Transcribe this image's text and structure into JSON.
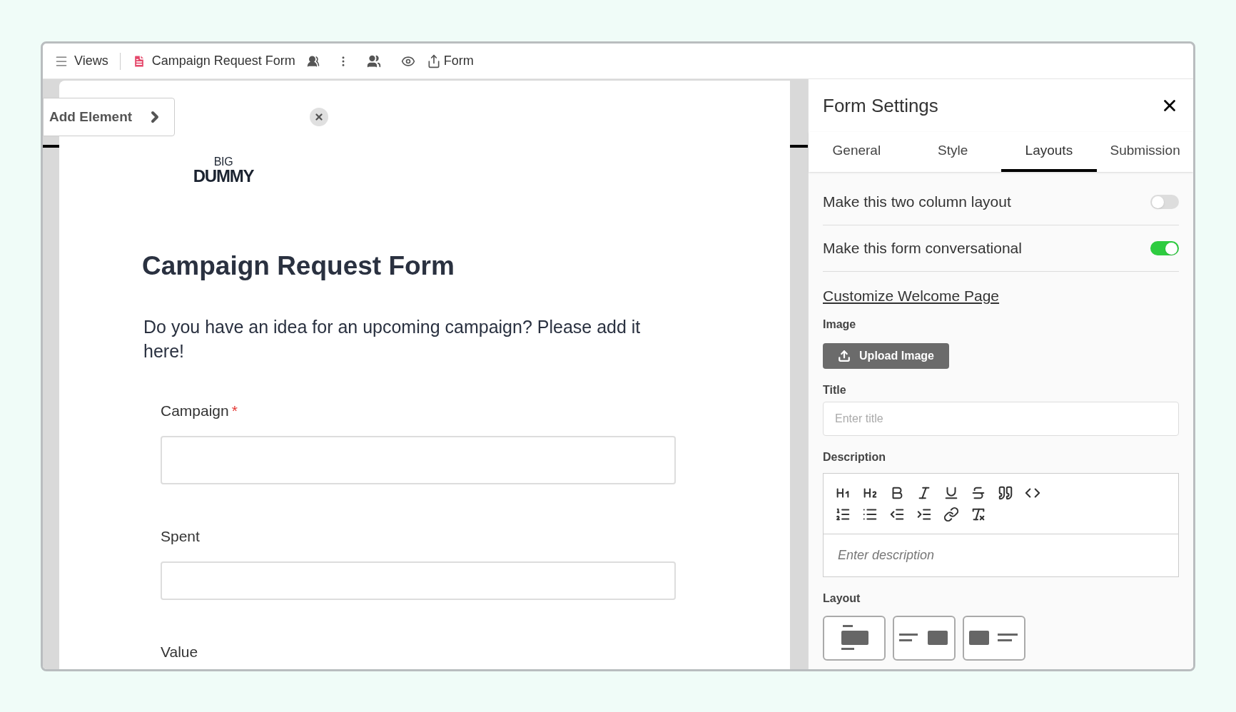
{
  "top_bar": {
    "views_label": "Views",
    "form_name": "Campaign Request Form",
    "form_label": "Form"
  },
  "canvas": {
    "add_element": "Add Element",
    "logo": {
      "top": "BIG",
      "main": "DUMMY"
    },
    "title": "Campaign Request Form",
    "description": "Do you have an idea for an upcoming campaign? Please add it here!",
    "fields": [
      {
        "label": "Campaign",
        "required_mark": "*",
        "kind": "tall"
      },
      {
        "label": "Spent",
        "kind": "short"
      },
      {
        "label": "Value",
        "kind": "cut"
      }
    ]
  },
  "settings": {
    "title": "Form Settings",
    "tabs": [
      {
        "label": "General",
        "selected": false
      },
      {
        "label": "Style",
        "selected": false
      },
      {
        "label": "Layouts",
        "selected": true
      },
      {
        "label": "Submission",
        "selected": false
      }
    ],
    "toggles": [
      {
        "label": "Make this two column layout",
        "on": false
      },
      {
        "label": "Make this form conversational",
        "on": true
      }
    ],
    "welcome_link": "Customize Welcome Page",
    "image_label": "Image",
    "upload_button": "Upload Image",
    "title_label": "Title",
    "title_placeholder": "Enter title",
    "description_label": "Description",
    "description_placeholder": "Enter description",
    "layout_label": "Layout",
    "layouts": [
      {
        "kind": "top"
      },
      {
        "kind": "right"
      },
      {
        "kind": "left"
      }
    ]
  }
}
